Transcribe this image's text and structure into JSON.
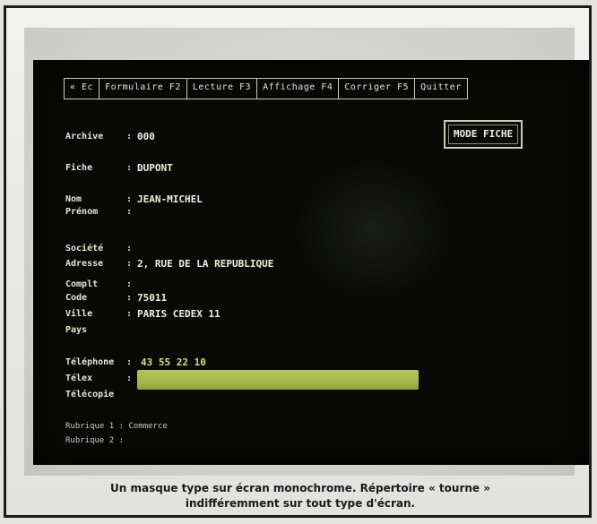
{
  "menu": {
    "items": [
      "« Ec",
      "Formulaire F2",
      "Lecture F3",
      "Affichage F4",
      "Corriger F5",
      "Quitter"
    ]
  },
  "mode_box": {
    "label": "MODE FICHE"
  },
  "form": {
    "fields": [
      {
        "label": "Archive",
        "value": "000"
      },
      {
        "label": "Fiche",
        "value": "DUPONT"
      },
      {
        "label": "Nom",
        "value": "JEAN-MICHEL"
      },
      {
        "label": "Prénom",
        "value": ""
      },
      {
        "label": "Société",
        "value": ""
      },
      {
        "label": "Adresse",
        "value": "2, RUE DE LA REPUBLIQUE"
      },
      {
        "label": "Complt",
        "value": ""
      },
      {
        "label": "Code",
        "value": "75011"
      },
      {
        "label": "Ville",
        "value": "PARIS CEDEX 11"
      },
      {
        "label": "Pays",
        "value": ""
      },
      {
        "label": "Téléphone",
        "value": "43 55 22 10"
      },
      {
        "label": "Télex",
        "value": ""
      },
      {
        "label": "Télécopie",
        "value": ""
      }
    ],
    "bottom_lines": [
      "Rubrique 1 : Commerce",
      "Rubrique 2 :"
    ]
  },
  "caption": {
    "line1": "Un masque type sur écran monochrome. Répertoire « tourne »",
    "line2": "indifféremment sur tout type d'écran."
  }
}
